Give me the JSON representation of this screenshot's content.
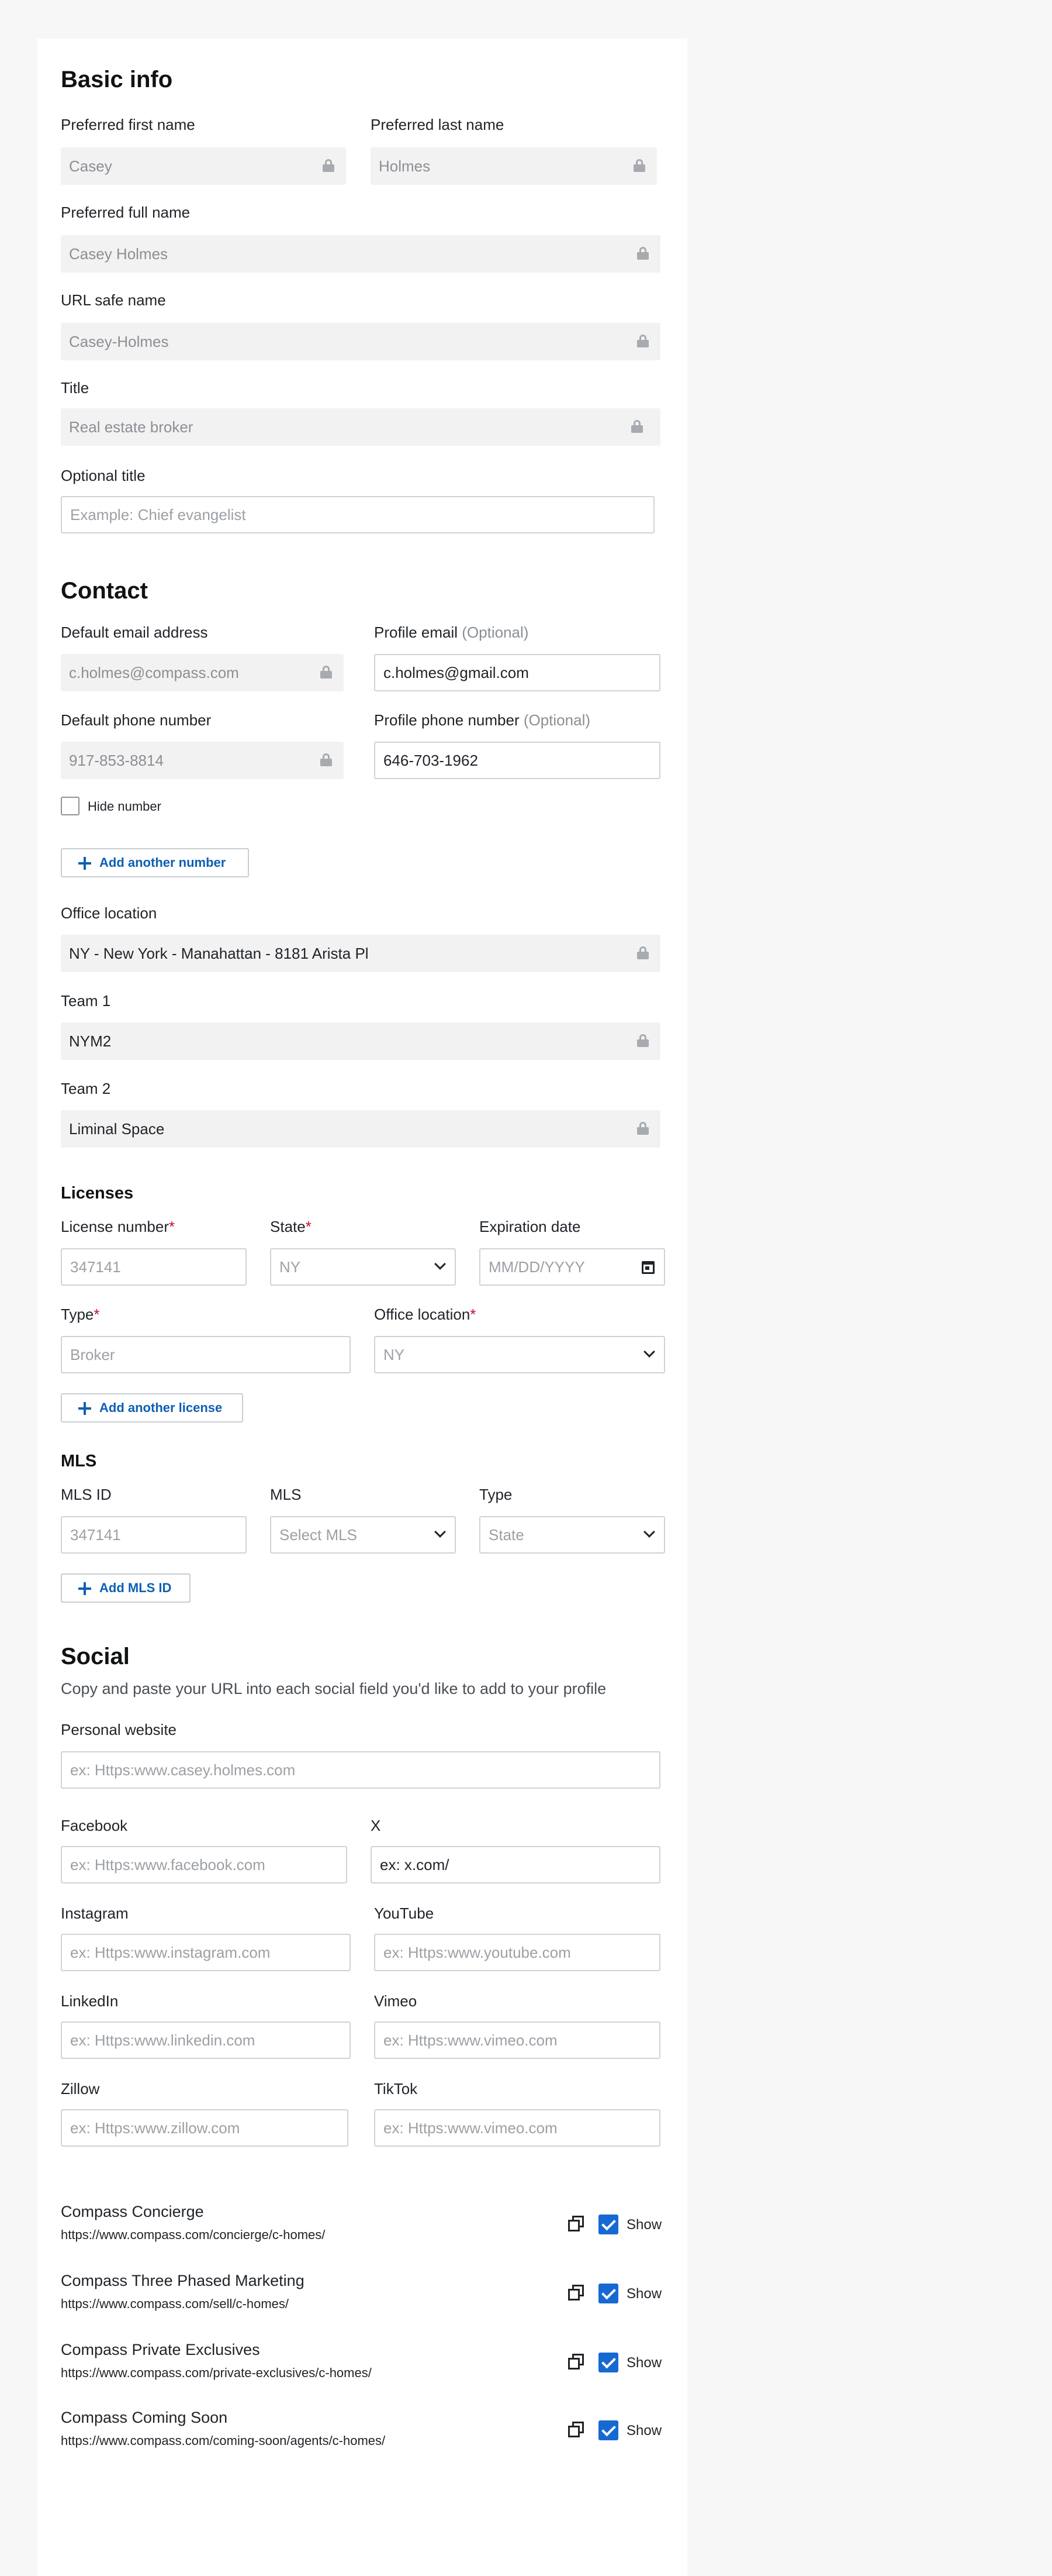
{
  "basic_info": {
    "title": "Basic info",
    "first_name_label": "Preferred first name",
    "first_name_value": "Casey",
    "last_name_label": "Preferred last name",
    "last_name_value": "Holmes",
    "full_name_label": "Preferred full name",
    "full_name_value": "Casey Holmes",
    "url_label": "URL safe name",
    "url_value": "Casey-Holmes",
    "title_label": "Title",
    "title_value": "Real estate broker",
    "optional_title_label": "Optional title",
    "optional_title_placeholder": "Example: Chief evangelist"
  },
  "contact": {
    "title": "Contact",
    "default_email_label": "Default email address",
    "default_email_value": "c.holmes@compass.com",
    "profile_email_label": "Profile email",
    "profile_email_optional": "(Optional)",
    "profile_email_value": "c.holmes@gmail.com",
    "default_phone_label": "Default phone number",
    "default_phone_value": "917-853-8814",
    "profile_phone_label": "Profile phone number",
    "profile_phone_optional": "(Optional)",
    "profile_phone_value": "646-703-1962",
    "hide_number_label": "Hide number",
    "add_number_label": "Add another number",
    "office_location_label": "Office location",
    "office_location_value": "NY - New York - Manahattan - 8181 Arista Pl",
    "team1_label": "Team 1",
    "team1_value": "NYM2",
    "team2_label": "Team 2",
    "team2_value": "Liminal Space"
  },
  "licenses": {
    "title": "Licenses",
    "license_number_label": "License number",
    "license_number_placeholder": "347141",
    "state_label": "State",
    "state_placeholder": "NY",
    "expiration_label": "Expiration date",
    "expiration_placeholder": "MM/DD/YYYY",
    "type_label": "Type",
    "type_placeholder": "Broker",
    "office_location_label": "Office location",
    "office_location_placeholder": "NY",
    "required_mark": "*",
    "add_license_label": "Add another license"
  },
  "mls": {
    "title": "MLS",
    "mls_id_label": "MLS ID",
    "mls_id_placeholder": "347141",
    "mls_label": "MLS",
    "mls_placeholder": "Select MLS",
    "type_label": "Type",
    "type_placeholder": "State",
    "add_mls_label": "Add MLS ID"
  },
  "social": {
    "title": "Social",
    "description": "Copy and paste your URL into each social field you'd like to add to your profile",
    "personal_website_label": "Personal website",
    "personal_website_placeholder": "ex: Https:www.casey.holmes.com",
    "facebook_label": "Facebook",
    "facebook_placeholder": "ex: Https:www.facebook.com",
    "x_label": "X",
    "x_value": "ex: x.com/",
    "instagram_label": "Instagram",
    "instagram_placeholder": "ex: Https:www.instagram.com",
    "youtube_label": "YouTube",
    "youtube_placeholder": "ex: Https:www.youtube.com",
    "linkedin_label": "LinkedIn",
    "linkedin_placeholder": "ex: Https:www.linkedin.com",
    "vimeo_label": "Vimeo",
    "vimeo_placeholder": "ex: Https:www.vimeo.com",
    "zillow_label": "Zillow",
    "zillow_placeholder": "ex: Https:www.zillow.com",
    "tiktok_label": "TikTok",
    "tiktok_placeholder": "ex: Https:www.vimeo.com"
  },
  "links": [
    {
      "title": "Compass Concierge",
      "url": "https://www.compass.com/concierge/c-homes/",
      "show_label": "Show"
    },
    {
      "title": "Compass Three Phased Marketing",
      "url": "https://www.compass.com/sell/c-homes/",
      "show_label": "Show"
    },
    {
      "title": "Compass Private Exclusives",
      "url": "https://www.compass.com/private-exclusives/c-homes/",
      "show_label": "Show"
    },
    {
      "title": "Compass Coming Soon",
      "url": "https://www.compass.com/coming-soon/agents/c-homes/",
      "show_label": "Show"
    }
  ],
  "colors": {
    "accent": "#1769d2",
    "link": "#0d5fb3",
    "required": "#c8102e",
    "locked_bg": "#f2f2f2"
  }
}
